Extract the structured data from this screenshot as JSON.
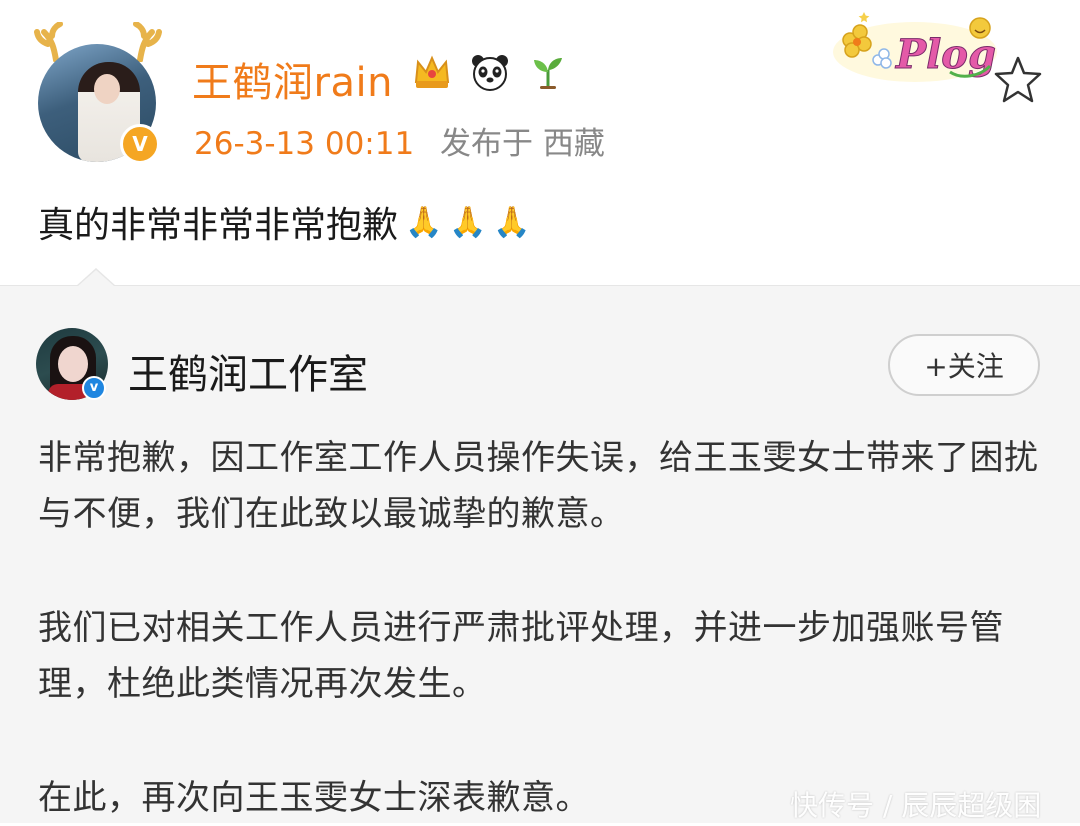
{
  "post": {
    "username": "王鹤润rain",
    "badges": [
      "crown-icon",
      "panda-icon",
      "sprout-icon"
    ],
    "time": "26-3-13 00:11",
    "location": "发布于 西藏",
    "decoration": "Plog",
    "text": "真的非常非常非常抱歉",
    "emoji": [
      "🙏",
      "🙏",
      "🙏"
    ]
  },
  "quoted": {
    "name": "王鹤润工作室",
    "follow_label": "+关注",
    "paragraphs": [
      "非常抱歉，因工作室工作人员操作失误，给王玉雯女士带来了困扰与不便，我们在此致以最诚挚的歉意。",
      "我们已对相关工作人员进行严肃批评处理，并进一步加强账号管理，杜绝此类情况再次发生。",
      "在此，再次向王玉雯女士深表歉意。"
    ]
  },
  "watermark": "快传号 / 辰辰超级困",
  "colors": {
    "username": "#f07b1a",
    "meta_time": "#f07b1a",
    "meta_loc": "#888888",
    "card_bg": "#f5f5f5"
  }
}
